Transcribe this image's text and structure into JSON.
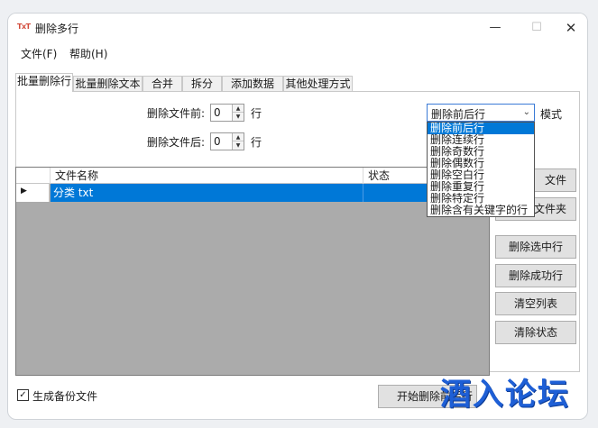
{
  "window": {
    "title": "删除多行",
    "app_icon_text": "TxT"
  },
  "menu": [
    {
      "label": "文件(F)"
    },
    {
      "label": "帮助(H)"
    }
  ],
  "tabs": [
    {
      "label": "批量删除行",
      "active": true
    },
    {
      "label": "批量删除文本"
    },
    {
      "label": "合并"
    },
    {
      "label": "拆分"
    },
    {
      "label": "添加数据"
    },
    {
      "label": "其他处理方式"
    }
  ],
  "controls": {
    "before_label": "删除文件前:",
    "before_value": "0",
    "after_label": "删除文件后:",
    "after_value": "0",
    "row_unit": "行",
    "mode_label": "模式",
    "mode_selected": "删除前后行",
    "mode_options": [
      "删除前后行",
      "删除连续行",
      "删除奇数行",
      "删除偶数行",
      "删除空白行",
      "删除重复行",
      "删除特定行",
      "删除含有关键字的行"
    ]
  },
  "table": {
    "columns": [
      "文件名称",
      "状态"
    ],
    "rows": [
      {
        "name": "分类 txt",
        "status": ""
      }
    ]
  },
  "side_buttons": {
    "add_file": "文件",
    "add_folder": "文件夹",
    "delete_selected": "删除选中行",
    "delete_success": "删除成功行",
    "clear_list": "清空列表",
    "clear_status": "清除状态"
  },
  "footer": {
    "backup_label": "生成备份文件",
    "backup_checked": true,
    "start_button": "开始删除前后行"
  },
  "watermark": "酒入论坛",
  "colors": {
    "selection": "#0078d7",
    "watermark": "#1e5fd6"
  }
}
